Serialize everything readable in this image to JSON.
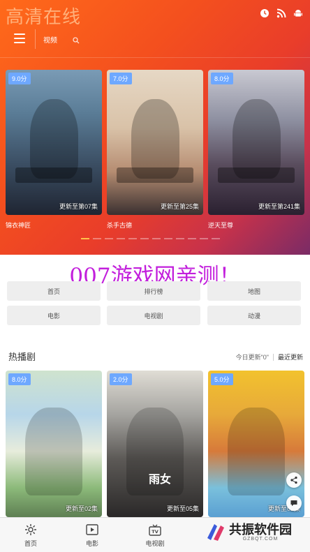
{
  "app": {
    "logo": "高清在线"
  },
  "header": {
    "icons": [
      "clock-icon",
      "rss-icon",
      "android-icon"
    ],
    "nav_video": "视频"
  },
  "carousel": {
    "items": [
      {
        "rating": "9.0分",
        "episode": "更新至第07集",
        "title": "锦衣神匠"
      },
      {
        "rating": "7.0分",
        "episode": "更新至第25集",
        "title": "杀手古德"
      },
      {
        "rating": "8.0分",
        "episode": "更新至第241集",
        "title": "逆天至尊"
      }
    ],
    "dot_count": 12,
    "active_dot": 0
  },
  "watermark": "007游戏网亲测！",
  "categories": [
    "首页",
    "排行榜",
    "地图",
    "电影",
    "电视剧",
    "动漫"
  ],
  "section": {
    "title": "热播剧",
    "today_update": "今日更新\"0\"",
    "latest_update": "最近更新"
  },
  "cards": [
    {
      "rating": "8.0分",
      "episode": "更新至02集"
    },
    {
      "rating": "2.0分",
      "episode": "更新至05集",
      "overlay": "雨女"
    },
    {
      "rating": "5.0分",
      "episode": "更新至02集"
    }
  ],
  "tabbar": {
    "items": [
      {
        "label": "首页",
        "icon": "home-icon"
      },
      {
        "label": "电影",
        "icon": "movie-icon"
      },
      {
        "label": "电视剧",
        "icon": "tv-icon"
      }
    ]
  },
  "brand": {
    "name": "共振软件园",
    "url": "GZBQT.COM"
  },
  "colors": {
    "accent": "#ff6a1a",
    "rating_badge": "#6ea8ff",
    "active_dot": "#ffc24a",
    "watermark": "#c21fdc"
  }
}
